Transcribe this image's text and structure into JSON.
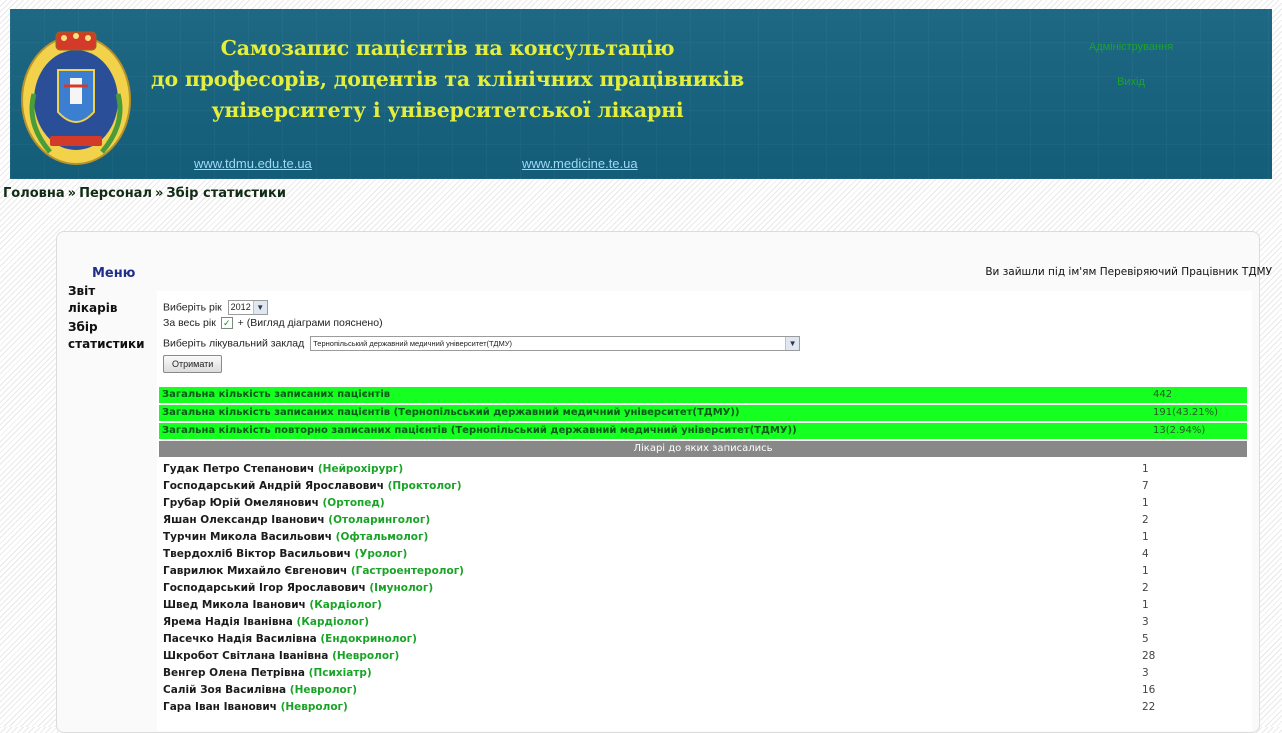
{
  "header": {
    "title_lines": [
      "Самозапис пацієнтів на консультацію",
      "до професорів, доцентів та клінічних працівників",
      "університету і університетської лікарні"
    ],
    "link_tdmu": "www.tdmu.edu.te.ua",
    "link_medicine": "www.medicine.te.ua",
    "admin_link": "Адміністрування",
    "exit_link": "Вихід"
  },
  "breadcrumb": [
    "Головна",
    "Персонал",
    "Збір статистики"
  ],
  "breadcrumb_sep": "»",
  "menu": {
    "title": "Меню",
    "items": [
      "Звіт лікарів",
      "Збір статистики"
    ]
  },
  "logged_as": "Ви зайшли під ім'ям Перевіряючий Працівник ТДМУ",
  "form": {
    "year_label": "Виберіть рік",
    "year_value": "2012",
    "all_year_label": "За весь рік",
    "all_year_checked": true,
    "all_year_note": "+ (Вигляд діаграми пояснено)",
    "institution_label": "Виберіть лікувальний заклад",
    "institution_value": "Тернопільський державний медичний університет(ТДМУ)",
    "submit_label": "Отримати"
  },
  "stats": [
    {
      "label": "Загальна кількість записаних пацієнтів",
      "value": "442"
    },
    {
      "label": "Загальна кількість записаних пацієнтів (Тернопільський державний медичний університет(ТДМУ))",
      "value": "191(43.21%)"
    },
    {
      "label": "Загальна кількість повторно записаних пацієнтів (Тернопільський державний медичний університет(ТДМУ))",
      "value": "13(2.94%)"
    }
  ],
  "doctors_header": "Лікарі до яких записались",
  "doctors": [
    {
      "name": "Гудак Петро Степанович",
      "spec": "(Нейрохірург)",
      "count": "1"
    },
    {
      "name": "Господарський Андрій Ярославович",
      "spec": "(Проктолог)",
      "count": "7"
    },
    {
      "name": "Грубар Юрій Омелянович",
      "spec": "(Ортопед)",
      "count": "1"
    },
    {
      "name": "Яшан Олександр Іванович",
      "spec": "(Отоларинголог)",
      "count": "2"
    },
    {
      "name": "Турчин Микола Васильович",
      "spec": "(Офтальмолог)",
      "count": "1"
    },
    {
      "name": "Твердохліб Віктор Васильович",
      "spec": "(Уролог)",
      "count": "4"
    },
    {
      "name": "Гаврилюк Михайло Євгенович",
      "spec": "(Гастроентеролог)",
      "count": "1"
    },
    {
      "name": "Господарський Ігор Ярославович",
      "spec": "(Імунолог)",
      "count": "2"
    },
    {
      "name": "Швед Микола Іванович",
      "spec": "(Кардіолог)",
      "count": "1"
    },
    {
      "name": "Ярема Надія Іванівна",
      "spec": "(Кардіолог)",
      "count": "3"
    },
    {
      "name": "Пасечко Надія Василівна",
      "spec": "(Ендокринолог)",
      "count": "5"
    },
    {
      "name": "Шкробот Світлана Іванівна",
      "spec": "(Невролог)",
      "count": "28"
    },
    {
      "name": "Венгер Олена Петрівна",
      "spec": "(Психіатр)",
      "count": "3"
    },
    {
      "name": "Салій Зоя Василівна",
      "spec": "(Невролог)",
      "count": "16"
    },
    {
      "name": "Гара Іван Іванович",
      "spec": "(Невролог)",
      "count": "22"
    }
  ]
}
